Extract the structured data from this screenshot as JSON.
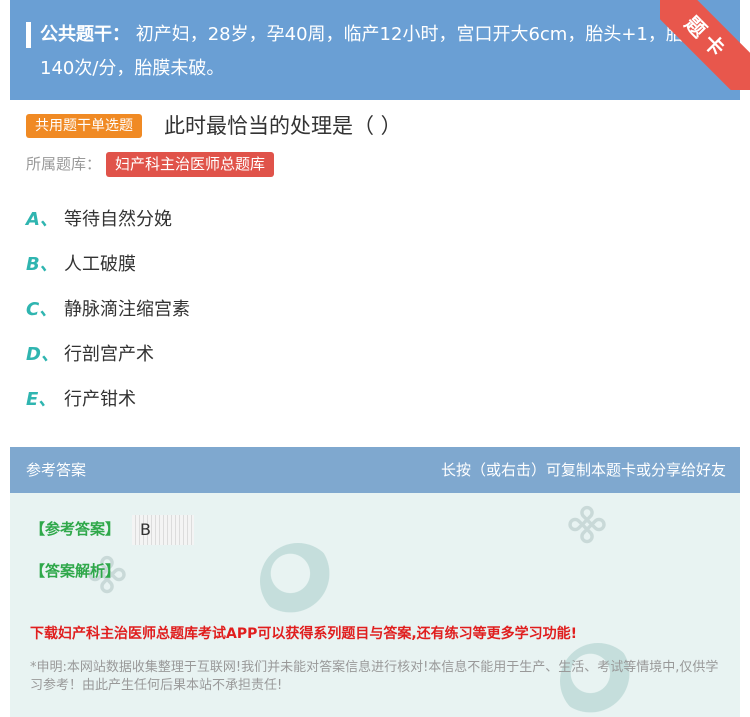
{
  "stem": {
    "label": "公共题干：",
    "text": "初产妇，28岁，孕40周，临产12小时，宫口开大6cm，胎头+1，胎心140次/分，胎膜未破。"
  },
  "ribbon": {
    "text": "题卡"
  },
  "question": {
    "type_tag": "共用题干单选题",
    "text": "此时最恰当的处理是（ ）",
    "bank_label": "所属题库：",
    "bank_name": "妇产科主治医师总题库"
  },
  "options": [
    {
      "letter": "A、",
      "text": "等待自然分娩"
    },
    {
      "letter": "B、",
      "text": "人工破膜"
    },
    {
      "letter": "C、",
      "text": "静脉滴注缩宫素"
    },
    {
      "letter": "D、",
      "text": "行剖宫产术"
    },
    {
      "letter": "E、",
      "text": "行产钳术"
    }
  ],
  "answer_section": {
    "title": "参考答案",
    "share_hint": "长按（或右击）可复制本题卡或分享给好友",
    "answer_label": "【参考答案】",
    "answer_value": "B",
    "analysis_label": "【答案解析】",
    "promo": "下载妇产科主治医师总题库考试APP可以获得系列题目与答案,还有练习等更多学习功能!",
    "disclaimer": "*申明:本网站数据收集整理于互联网!我们并未能对答案信息进行核对!本信息不能用于生产、生活、考试等情境中,仅供学习参考！由此产生任何后果本站不承担责任!"
  },
  "colors": {
    "stem_bg": "#6a9fd4",
    "ribbon": "#e8574c",
    "type_tag": "#f08a24",
    "bank_tag": "#e0534a",
    "option_letter": "#2fb5b0",
    "answer_head": "#7fa8cf",
    "answer_body": "#e8f3f2",
    "answer_label": "#2fa84a",
    "promo": "#e01e1e"
  }
}
